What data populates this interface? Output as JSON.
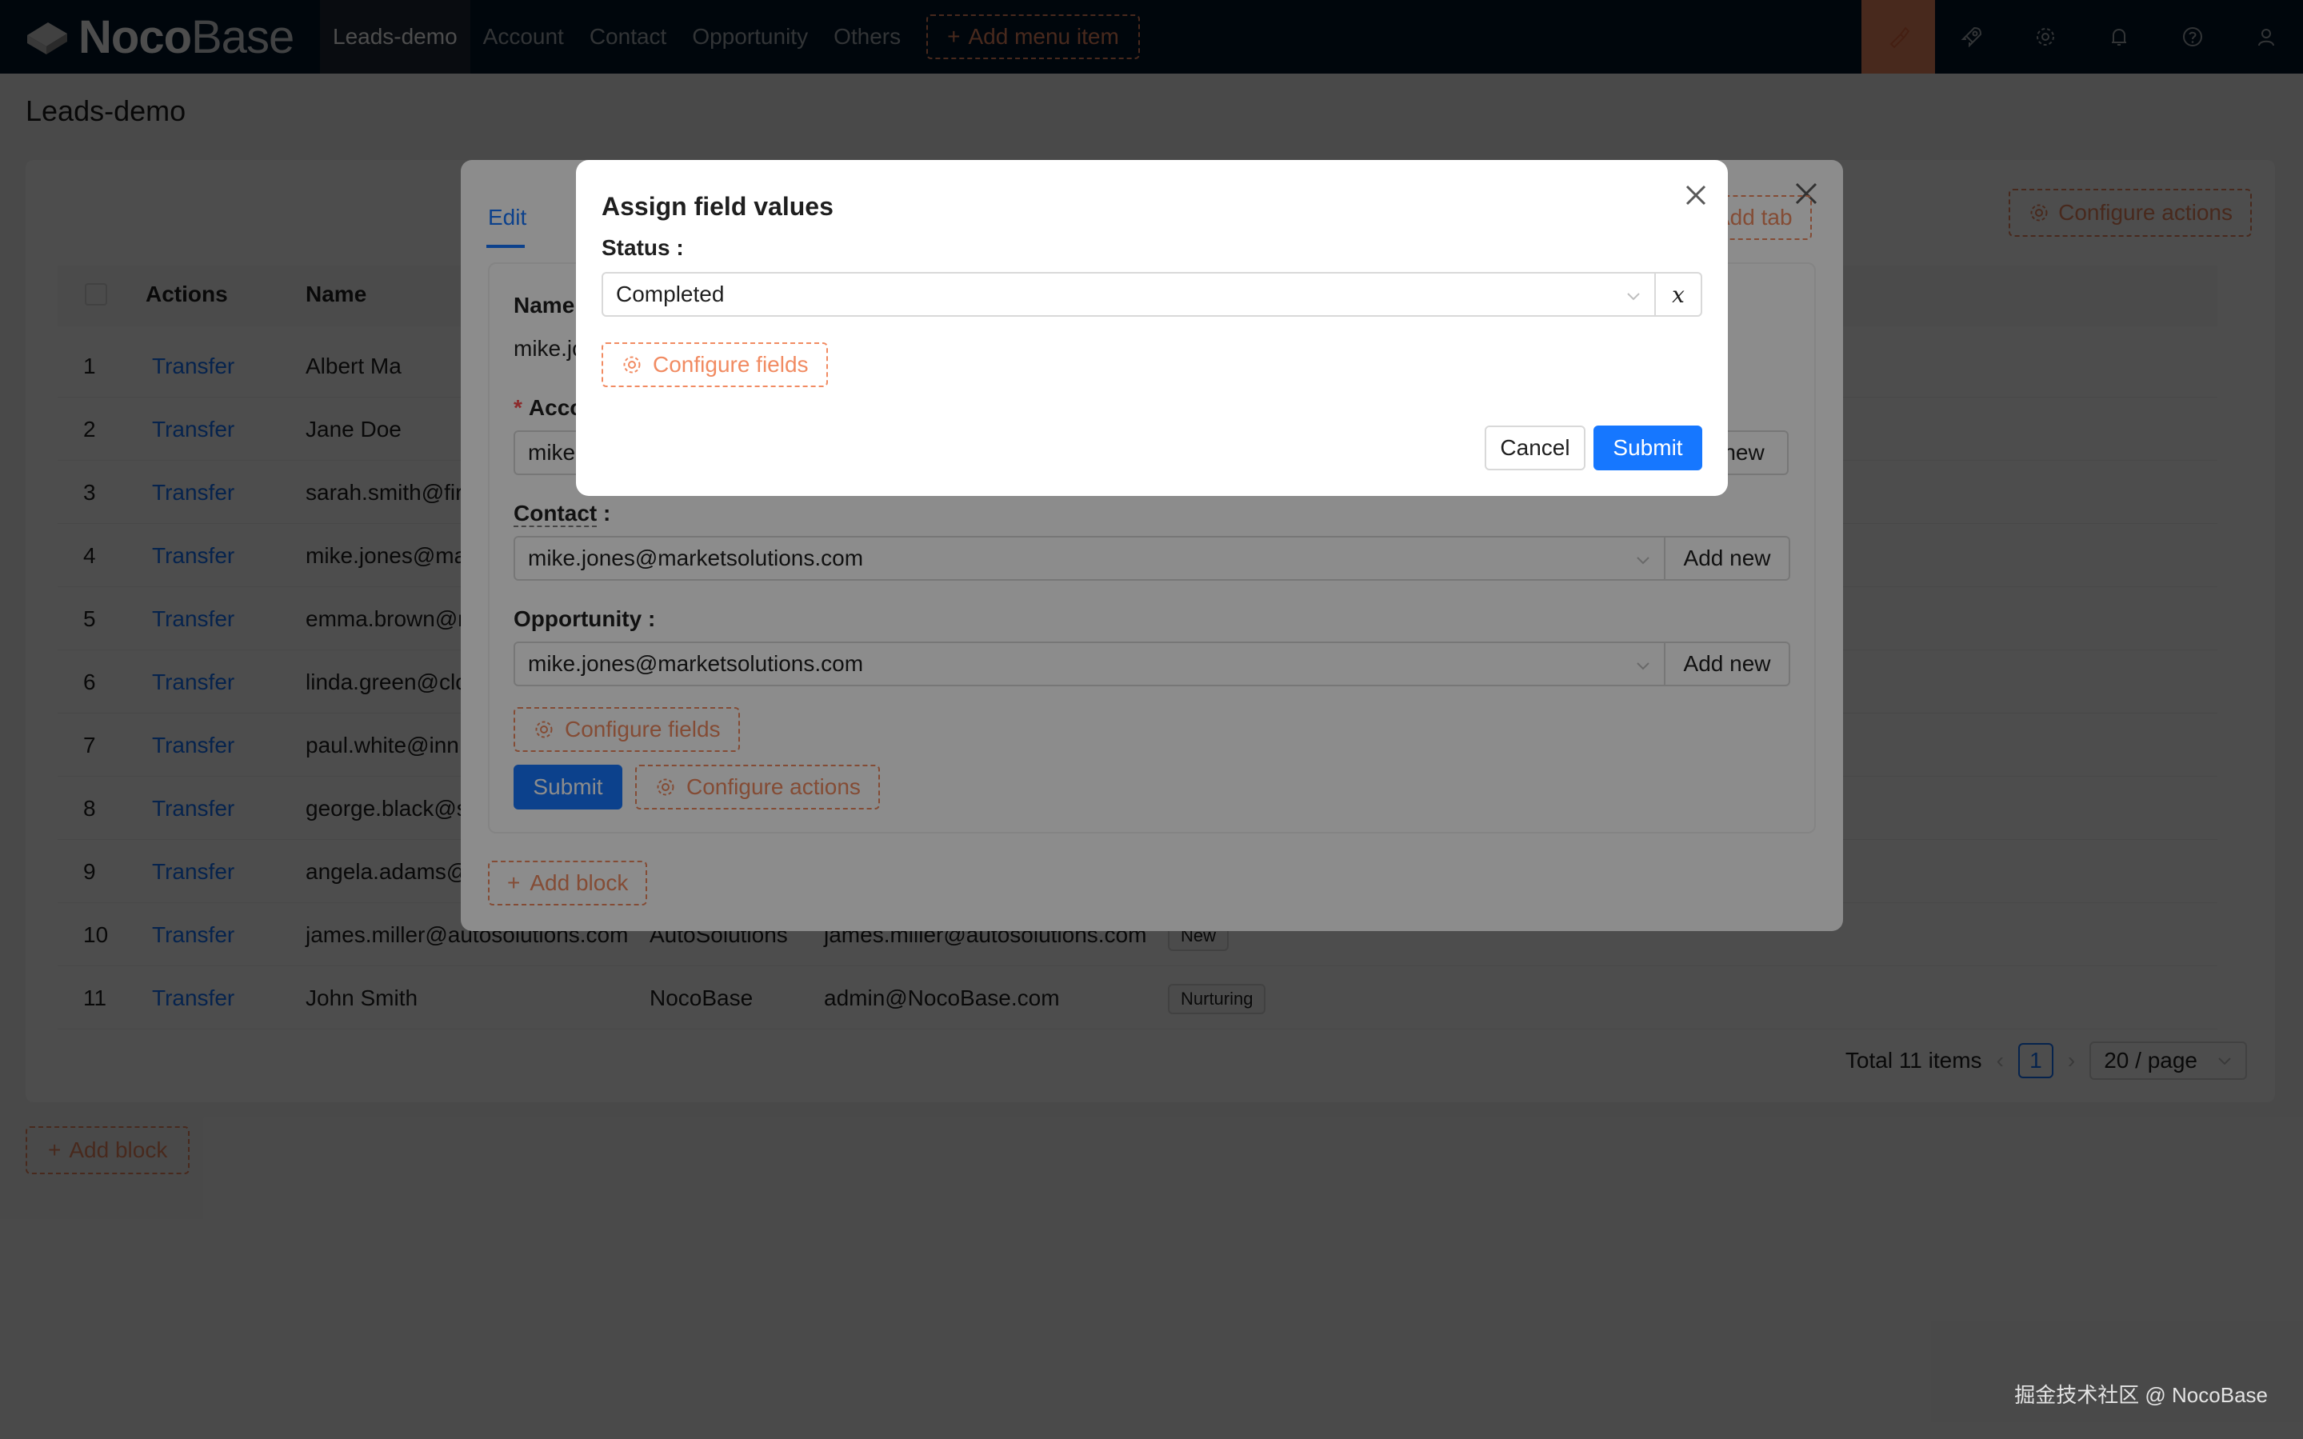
{
  "app": {
    "logo_bold": "Noco",
    "logo_light": "Base"
  },
  "nav": {
    "items": [
      "Leads-demo",
      "Account",
      "Contact",
      "Opportunity",
      "Others"
    ],
    "add_menu_item": "Add menu item",
    "icons": [
      "brush-icon",
      "rocket-icon",
      "gear-icon",
      "bell-icon",
      "help-icon",
      "user-icon"
    ]
  },
  "page": {
    "title": "Leads-demo",
    "configure_actions": "Configure actions",
    "add_block": "Add block"
  },
  "table": {
    "columns": [
      "Actions",
      "Name"
    ],
    "rows": [
      {
        "num": "1",
        "action": "Transfer",
        "name": "Albert Ma",
        "company": "",
        "email": "",
        "status": ""
      },
      {
        "num": "2",
        "action": "Transfer",
        "name": "Jane Doe",
        "company": "",
        "email": "",
        "status": ""
      },
      {
        "num": "3",
        "action": "Transfer",
        "name": "sarah.smith@fir",
        "company": "",
        "email": "",
        "status": ""
      },
      {
        "num": "4",
        "action": "Transfer",
        "name": "mike.jones@ma",
        "company": "",
        "email": "",
        "status": ""
      },
      {
        "num": "5",
        "action": "Transfer",
        "name": "emma.brown@r",
        "company": "",
        "email": "",
        "status": ""
      },
      {
        "num": "6",
        "action": "Transfer",
        "name": "linda.green@clo",
        "company": "",
        "email": "",
        "status": ""
      },
      {
        "num": "7",
        "action": "Transfer",
        "name": "paul.white@inn",
        "company": "",
        "email": "",
        "status": ""
      },
      {
        "num": "8",
        "action": "Transfer",
        "name": "george.black@s",
        "company": "",
        "email": "",
        "status": ""
      },
      {
        "num": "9",
        "action": "Transfer",
        "name": "angela.adams@",
        "company": "",
        "email": "",
        "status": ""
      },
      {
        "num": "10",
        "action": "Transfer",
        "name": "james.miller@autosolutions.com",
        "company": "AutoSolutions",
        "email": "james.miller@autosolutions.com",
        "status": "New"
      },
      {
        "num": "11",
        "action": "Transfer",
        "name": "John Smith",
        "company": "NocoBase",
        "email": "admin@NocoBase.com",
        "status": "Nurturing"
      }
    ],
    "total": "Total 11 items",
    "current_page": "1",
    "page_size": "20 / page"
  },
  "drawer": {
    "tab": "Edit",
    "add_tab": "Add tab",
    "name_label": "Name",
    "name_value": "mike.jo",
    "account_label": "Acco",
    "account_value": "mike",
    "contact_label": "Contact",
    "contact_value": "mike.jones@marketsolutions.com",
    "opportunity_label": "Opportunity",
    "opportunity_value": "mike.jones@marketsolutions.com",
    "add_new": "Add new",
    "add_new_partial": "new",
    "configure_fields": "Configure fields",
    "submit": "Submit",
    "configure_actions": "Configure actions",
    "add_block": "Add block"
  },
  "modal": {
    "title": "Assign field values",
    "status_label": "Status",
    "status_value": "Completed",
    "variable_button": "x",
    "configure_fields": "Configure fields",
    "cancel": "Cancel",
    "submit": "Submit"
  },
  "watermark": "掘金技术社区 @ NocoBase",
  "colors": {
    "primary": "#1677ff",
    "accent": "#f18b62",
    "nav_bg": "#001529"
  }
}
